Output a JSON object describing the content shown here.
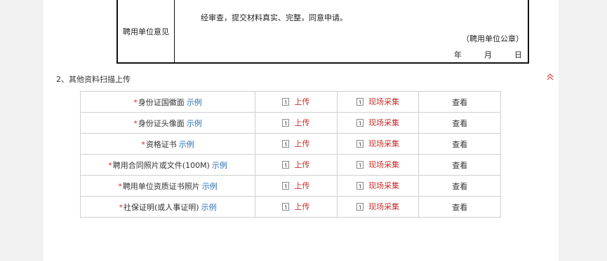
{
  "opinion": {
    "label": "聘用单位意见",
    "text": "经审查，提交材料真实、完整，同意申请。",
    "seal": "（聘用单位公章）",
    "date_year": "年",
    "date_month": "月",
    "date_day": "日"
  },
  "section": {
    "title": "2、其他资料扫描上传"
  },
  "upload_table": {
    "upload_label": "上传",
    "capture_label": "现场采集",
    "view_label": "查看",
    "example_label": "示例",
    "required_mark": "*",
    "rows": [
      {
        "name": "身份证国徽面"
      },
      {
        "name": "身份证头像面"
      },
      {
        "name": "资格证书"
      },
      {
        "name": "聘用合同照片或文件(100M)"
      },
      {
        "name": "聘用单位资质证书照片"
      },
      {
        "name": "社保证明(或人事证明)"
      }
    ]
  },
  "colors": {
    "accent_red": "#c9302c",
    "link_blue": "#2a6fb5"
  }
}
